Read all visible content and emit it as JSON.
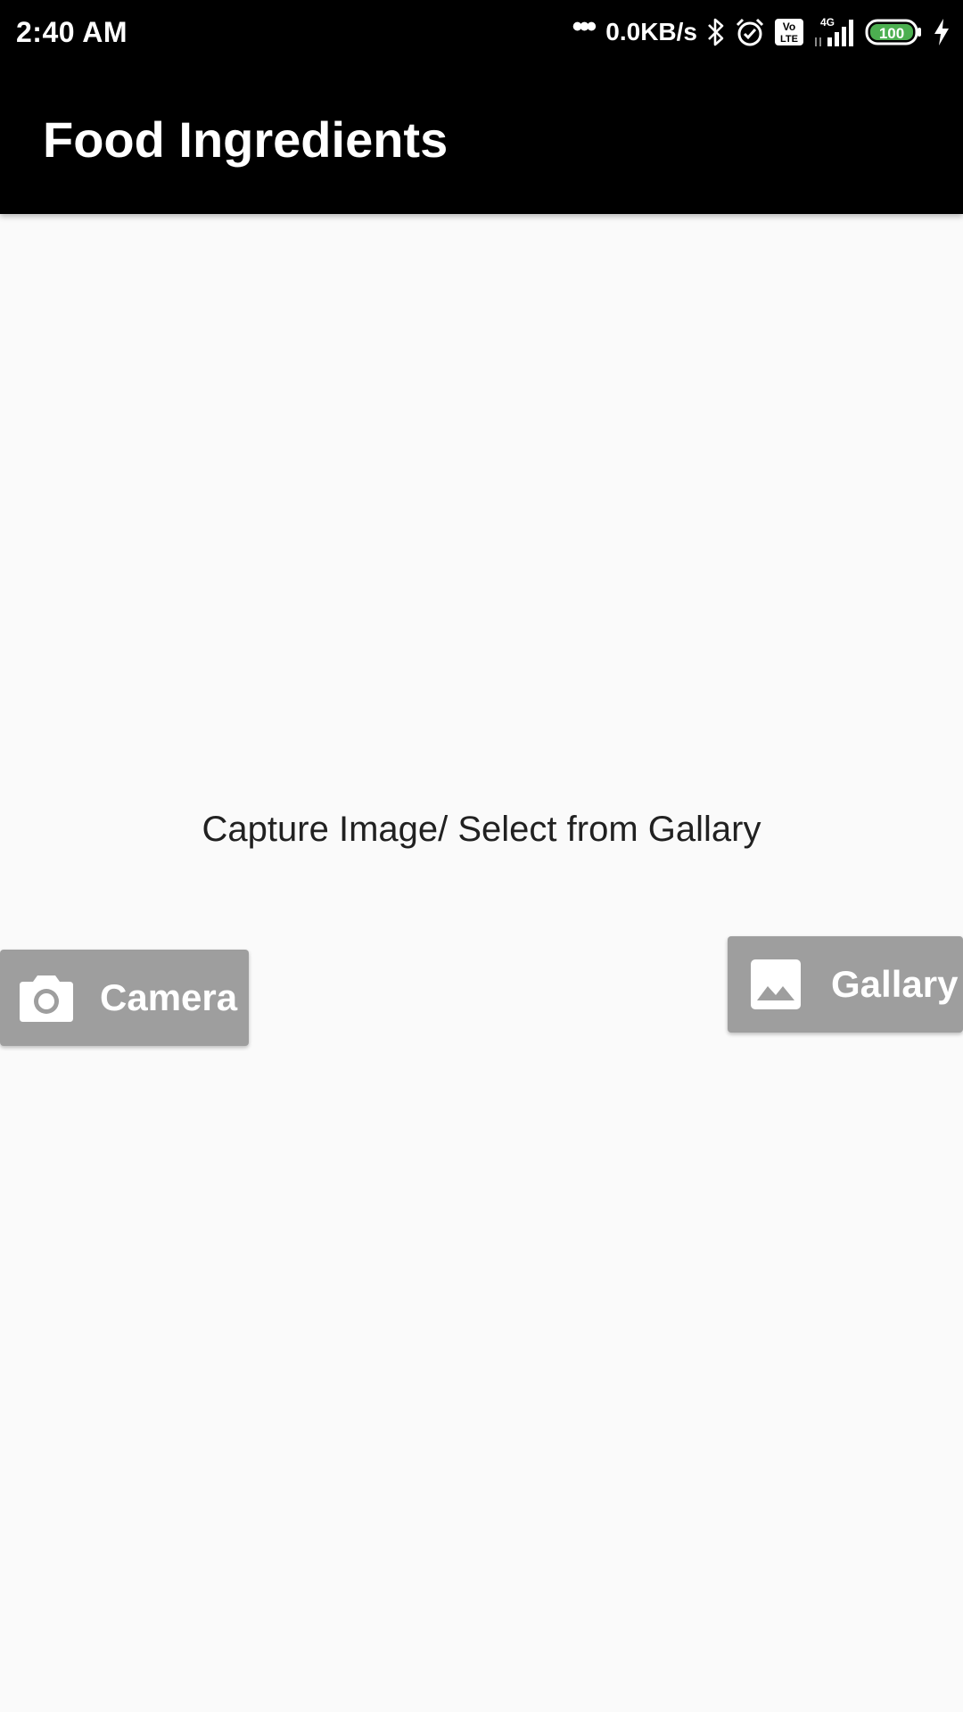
{
  "status_bar": {
    "time": "2:40 AM",
    "dots": "•••",
    "network_speed": "0.0KB/s",
    "icons": [
      "bluetooth-icon",
      "alarm-icon",
      "volte-icon",
      "signal-4g-icon",
      "battery-icon",
      "charging-icon"
    ],
    "battery_level": "100",
    "network_type": "4G",
    "volte_label_top": "Vo",
    "volte_label_bottom": "LTE"
  },
  "app_bar": {
    "title": "Food Ingredients"
  },
  "main": {
    "prompt": "Capture Image/ Select from Gallary",
    "camera_button": {
      "label": "Camera",
      "icon": "camera-icon"
    },
    "gallery_button": {
      "label": "Gallary",
      "icon": "image-icon"
    }
  },
  "colors": {
    "app_bar": "#000000",
    "background": "#fafafa",
    "button": "#9e9e9e",
    "battery_fill": "#4caf50"
  }
}
